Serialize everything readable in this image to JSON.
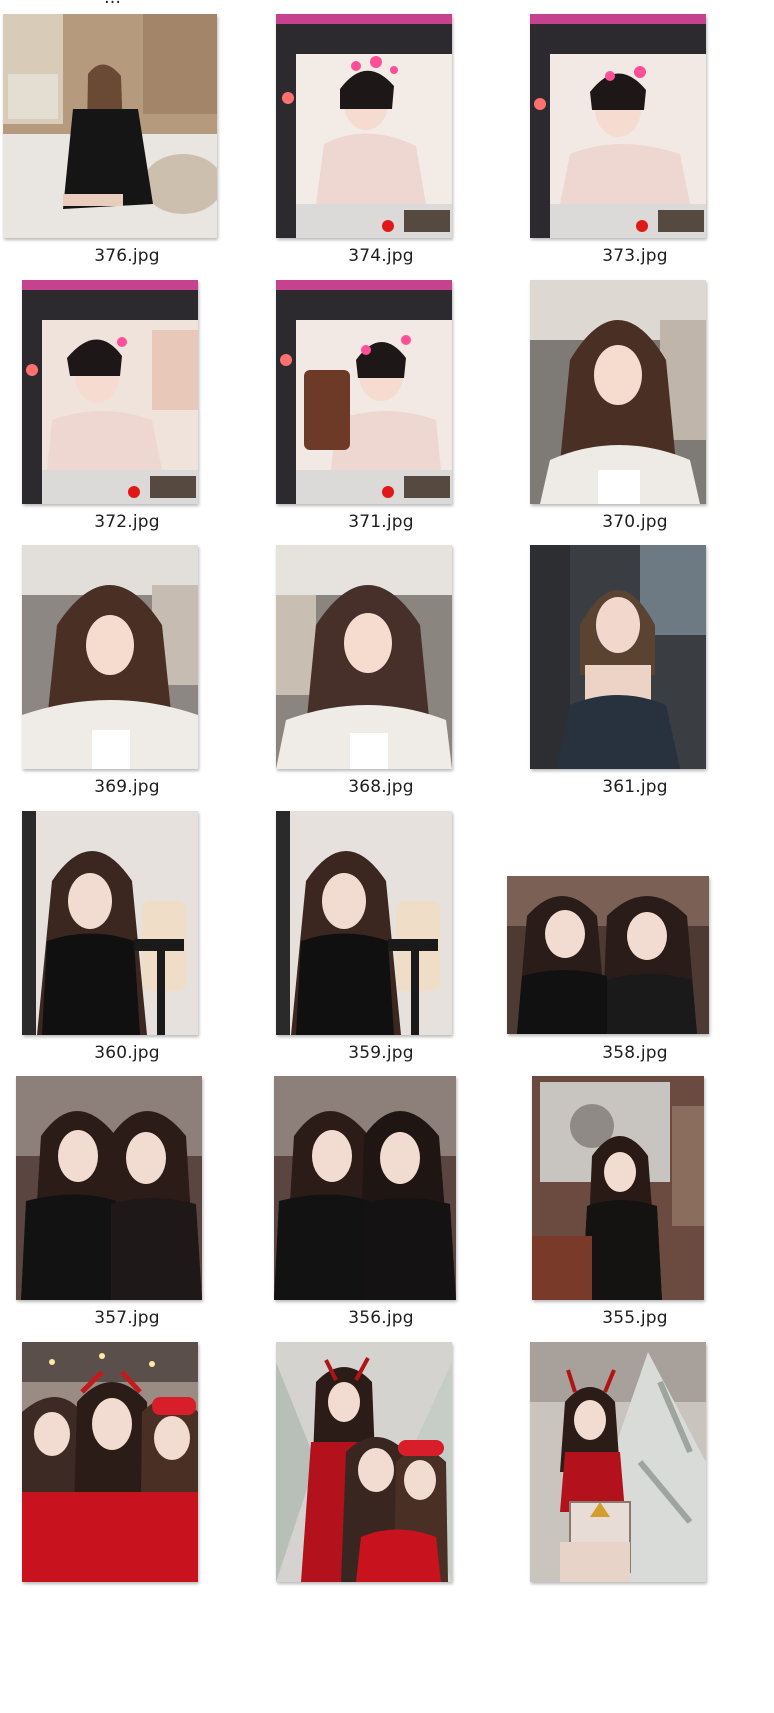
{
  "gallery": {
    "items": [
      {
        "label": "376.jpg",
        "icon": "image-thumbnail",
        "theme": "bedroom"
      },
      {
        "label": "374.jpg",
        "icon": "image-thumbnail",
        "theme": "videocall"
      },
      {
        "label": "373.jpg",
        "icon": "image-thumbnail",
        "theme": "videocall"
      },
      {
        "label": "372.jpg",
        "icon": "image-thumbnail",
        "theme": "videocall"
      },
      {
        "label": "371.jpg",
        "icon": "image-thumbnail",
        "theme": "videocall-phone"
      },
      {
        "label": "370.jpg",
        "icon": "image-thumbnail",
        "theme": "car-white"
      },
      {
        "label": "369.jpg",
        "icon": "image-thumbnail",
        "theme": "car-white"
      },
      {
        "label": "368.jpg",
        "icon": "image-thumbnail",
        "theme": "car-white"
      },
      {
        "label": "361.jpg",
        "icon": "image-thumbnail",
        "theme": "car-dark"
      },
      {
        "label": "360.jpg",
        "icon": "image-thumbnail",
        "theme": "mirror-black"
      },
      {
        "label": "359.jpg",
        "icon": "image-thumbnail",
        "theme": "mirror-black"
      },
      {
        "label": "358.jpg",
        "icon": "image-thumbnail",
        "theme": "duo-landscape"
      },
      {
        "label": "357.jpg",
        "icon": "image-thumbnail",
        "theme": "duo"
      },
      {
        "label": "356.jpg",
        "icon": "image-thumbnail",
        "theme": "duo"
      },
      {
        "label": "355.jpg",
        "icon": "image-thumbnail",
        "theme": "party"
      },
      {
        "label": "",
        "icon": "image-thumbnail",
        "theme": "xmas-trio"
      },
      {
        "label": "",
        "icon": "image-thumbnail",
        "theme": "xmas-tree-trio"
      },
      {
        "label": "",
        "icon": "image-thumbnail",
        "theme": "xmas-tree-solo"
      }
    ]
  },
  "colors": {
    "caption": "#1e1e1e",
    "background": "#ffffff"
  }
}
